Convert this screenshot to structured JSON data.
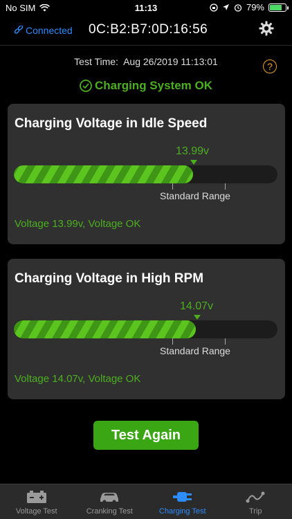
{
  "status_bar": {
    "carrier": "No SIM",
    "time": "11:13",
    "battery": "79%",
    "battery_level": 0.79
  },
  "header": {
    "connection": "Connected",
    "device_id": "0C:B2:B7:0D:16:56"
  },
  "test_time": {
    "label": "Test Time:",
    "value": "Aug 26/2019 11:13:01"
  },
  "system_status": "Charging System OK",
  "cards": [
    {
      "title": "Charging Voltage in Idle Speed",
      "value": "13.99v",
      "fill_fraction": 0.68,
      "range_label": "Standard Range",
      "status": "Voltage 13.99v, Voltage OK"
    },
    {
      "title": "Charging Voltage in High RPM",
      "value": "14.07v",
      "fill_fraction": 0.69,
      "range_label": "Standard Range",
      "status": "Voltage 14.07v, Voltage OK"
    }
  ],
  "action_button": "Test Again",
  "tabs": [
    {
      "label": "Voltage Test",
      "icon": "battery-icon",
      "active": false
    },
    {
      "label": "Cranking Test",
      "icon": "car-icon",
      "active": false
    },
    {
      "label": "Charging Test",
      "icon": "plug-icon",
      "active": true
    },
    {
      "label": "Trip",
      "icon": "route-icon",
      "active": false
    }
  ],
  "colors": {
    "accent_blue": "#2d8cff",
    "ok_green": "#4caf20",
    "help_orange": "#f0a020"
  }
}
